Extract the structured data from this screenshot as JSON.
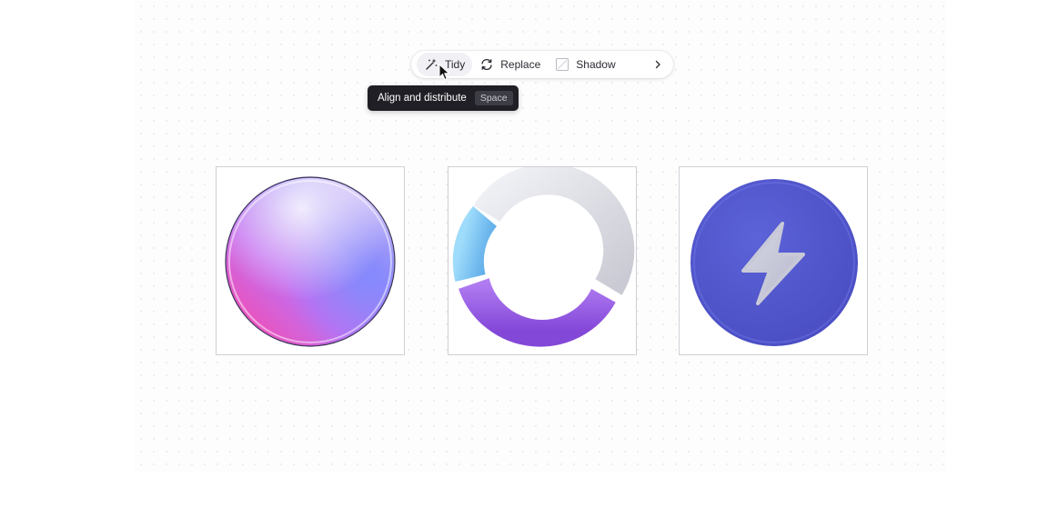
{
  "toolbar": {
    "tidy_label": "Tidy",
    "tidy_icon": "magic-wand-icon",
    "replace_label": "Replace",
    "replace_icon": "refresh-icon",
    "shadow_label": "Shadow",
    "shadow_icon": "shadow-square-icon",
    "more_icon": "chevron-right-icon"
  },
  "tooltip": {
    "text": "Align and distribute",
    "shortcut": "Space"
  },
  "canvas": {
    "items": [
      {
        "icon": "glass-sphere-icon"
      },
      {
        "icon": "ring-chart-icon"
      },
      {
        "icon": "lightning-badge-icon"
      }
    ]
  },
  "colors": {
    "accent": "#5459cf",
    "tooltip_bg": "#1f1f25",
    "ring_purple": "#9b5de8",
    "ring_blue": "#6fbef0",
    "ring_gray": "#e2e3ea"
  }
}
